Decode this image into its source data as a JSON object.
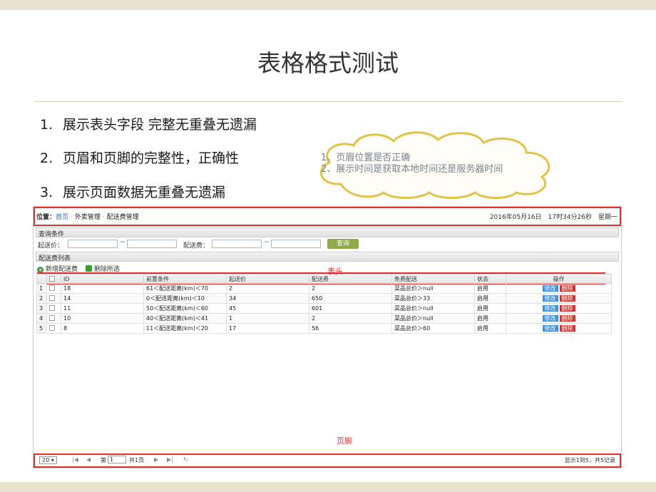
{
  "slide": {
    "title": "表格格式测试",
    "bullets": [
      {
        "num": "1.",
        "text": "展示表头字段 完整无重叠无遗漏"
      },
      {
        "num": "2.",
        "text": "页眉和页脚的完整性，正确性"
      },
      {
        "num": "3.",
        "text": "展示页面数据无重叠无遗漏"
      }
    ],
    "cloud": {
      "line1": "1、页眉位置是否正确",
      "line2": "2、展示时间是获取本地时间还是服务器时间"
    },
    "annotations": {
      "header": "表头",
      "footer": "页脚"
    }
  },
  "app": {
    "breadcrumb": {
      "location_label": "位置：",
      "home": "首页",
      "sep": "·",
      "item1": "外卖管理",
      "item2": "配送费管理"
    },
    "datetime": "2016年05月16日　17时34分26秒　星期一",
    "query_section": "查询条件",
    "filters": {
      "start_label": "起送价：",
      "tilde": "~",
      "fee_label": "配送费：",
      "query_button": "查询"
    },
    "list_section": "配送费列表",
    "toolbar": {
      "add": "新增配送费",
      "delete_selected": "删除所选"
    },
    "table": {
      "columns": [
        "",
        "",
        "ID",
        "前置条件",
        "起送价",
        "配送费",
        "免费配送",
        "状态",
        "操作"
      ],
      "rows": [
        {
          "rn": "1",
          "id": "18",
          "cond": "61＜配送距离(km)＜70",
          "start": "2",
          "fee": "2",
          "free": "菜品总价＞null",
          "status": "启用"
        },
        {
          "rn": "2",
          "id": "14",
          "cond": "0＜配送距离(km)＜10",
          "start": "34",
          "fee": "650",
          "free": "菜品总价＞33",
          "status": "启用"
        },
        {
          "rn": "3",
          "id": "11",
          "cond": "50＜配送距离(km)＜60",
          "start": "45",
          "fee": "601",
          "free": "菜品总价＞null",
          "status": "启用"
        },
        {
          "rn": "4",
          "id": "10",
          "cond": "40＜配送距离(km)＜41",
          "start": "1",
          "fee": "2",
          "free": "菜品总价＞null",
          "status": "启用"
        },
        {
          "rn": "5",
          "id": "8",
          "cond": "11＜配送距离(km)＜20",
          "start": "17",
          "fee": "56",
          "free": "菜品总价＞60",
          "status": "启用"
        }
      ],
      "edit_label": "修改",
      "delete_label": "删除"
    },
    "pager": {
      "page_size": "20",
      "page_prefix": "第",
      "page_value": "1",
      "page_total": "共1页",
      "summary": "显示1到5，共5记录"
    }
  },
  "colors": {
    "accent_red": "#e03030",
    "status_green": "#1d9a1d",
    "edit_blue": "#3e8fe0",
    "delete_red": "#d9302c",
    "query_green": "#8eaa4a"
  }
}
